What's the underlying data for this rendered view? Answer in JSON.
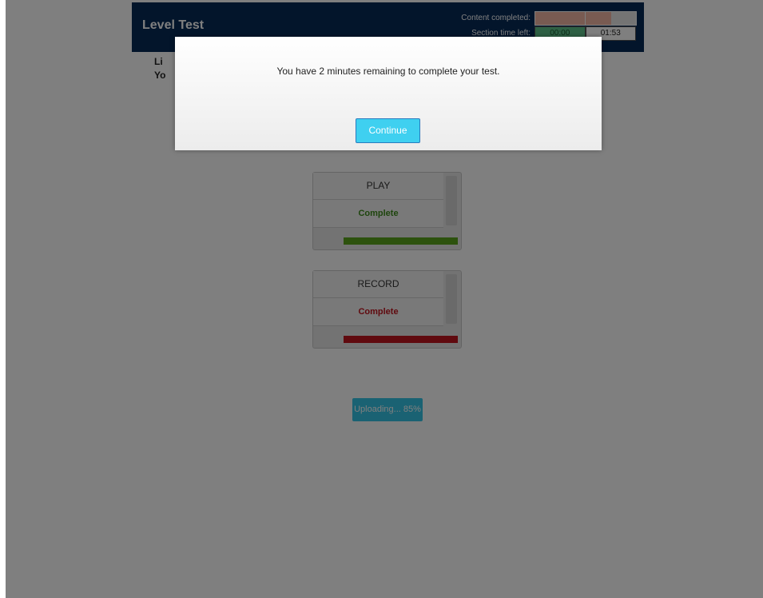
{
  "header": {
    "title": "Level Test",
    "content_completed_label": "Content completed:",
    "section_time_label": "Section time left:",
    "time_elapsed": "00:00",
    "time_left": "01:53"
  },
  "instructions": {
    "line1": "Li",
    "line2": "Yo"
  },
  "play_box": {
    "title": "PLAY",
    "status": "Complete",
    "status_color": "#3c8a1a",
    "progress": 1.0,
    "bar_color": "#5aa51c"
  },
  "record_box": {
    "title": "RECORD",
    "status": "Complete",
    "status_color": "#c0141e",
    "progress": 1.0,
    "bar_color": "#c0141e"
  },
  "upload_button": {
    "label": "Uploading... 85%"
  },
  "modal": {
    "message": "You have 2 minutes remaining to complete your test.",
    "continue_label": "Continue"
  },
  "colors": {
    "header_bg": "#062a57",
    "accent": "#3fd0f0"
  }
}
